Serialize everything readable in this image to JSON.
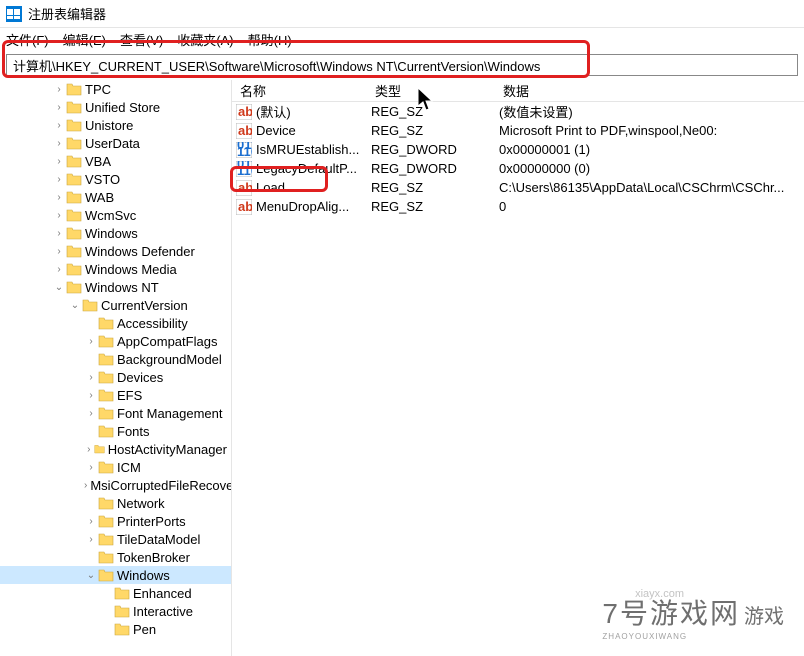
{
  "title": "注册表编辑器",
  "menu": {
    "file": "文件(F)",
    "edit": "编辑(E)",
    "view": "查看(V)",
    "favorites": "收藏夹(A)",
    "help": "帮助(H)"
  },
  "address": "计算机\\HKEY_CURRENT_USER\\Software\\Microsoft\\Windows NT\\CurrentVersion\\Windows",
  "list_headers": {
    "name": "名称",
    "type": "类型",
    "data": "数据"
  },
  "values": [
    {
      "icon": "sz",
      "name": "(默认)",
      "type": "REG_SZ",
      "data": "(数值未设置)"
    },
    {
      "icon": "sz",
      "name": "Device",
      "type": "REG_SZ",
      "data": "Microsoft Print to PDF,winspool,Ne00:"
    },
    {
      "icon": "dw",
      "name": "IsMRUEstablish...",
      "type": "REG_DWORD",
      "data": "0x00000001 (1)"
    },
    {
      "icon": "dw",
      "name": "LegacyDefaultP...",
      "type": "REG_DWORD",
      "data": "0x00000000 (0)"
    },
    {
      "icon": "sz",
      "name": "Load",
      "type": "REG_SZ",
      "data": "C:\\Users\\86135\\AppData\\Local\\CSChrm\\CSChr..."
    },
    {
      "icon": "sz",
      "name": "MenuDropAlig...",
      "type": "REG_SZ",
      "data": "0"
    }
  ],
  "tree": [
    {
      "indent": 3,
      "exp": ">",
      "label": "TPC"
    },
    {
      "indent": 3,
      "exp": ">",
      "label": "Unified Store"
    },
    {
      "indent": 3,
      "exp": ">",
      "label": "Unistore"
    },
    {
      "indent": 3,
      "exp": ">",
      "label": "UserData"
    },
    {
      "indent": 3,
      "exp": ">",
      "label": "VBA"
    },
    {
      "indent": 3,
      "exp": ">",
      "label": "VSTO"
    },
    {
      "indent": 3,
      "exp": ">",
      "label": "WAB"
    },
    {
      "indent": 3,
      "exp": ">",
      "label": "WcmSvc"
    },
    {
      "indent": 3,
      "exp": ">",
      "label": "Windows"
    },
    {
      "indent": 3,
      "exp": ">",
      "label": "Windows Defender"
    },
    {
      "indent": 3,
      "exp": ">",
      "label": "Windows Media"
    },
    {
      "indent": 3,
      "exp": "v",
      "label": "Windows NT"
    },
    {
      "indent": 4,
      "exp": "v",
      "label": "CurrentVersion"
    },
    {
      "indent": 5,
      "exp": "",
      "label": "Accessibility"
    },
    {
      "indent": 5,
      "exp": ">",
      "label": "AppCompatFlags"
    },
    {
      "indent": 5,
      "exp": "",
      "label": "BackgroundModel"
    },
    {
      "indent": 5,
      "exp": ">",
      "label": "Devices"
    },
    {
      "indent": 5,
      "exp": ">",
      "label": "EFS"
    },
    {
      "indent": 5,
      "exp": ">",
      "label": "Font Management"
    },
    {
      "indent": 5,
      "exp": "",
      "label": "Fonts"
    },
    {
      "indent": 5,
      "exp": ">",
      "label": "HostActivityManager"
    },
    {
      "indent": 5,
      "exp": ">",
      "label": "ICM"
    },
    {
      "indent": 5,
      "exp": ">",
      "label": "MsiCorruptedFileRecovery"
    },
    {
      "indent": 5,
      "exp": "",
      "label": "Network"
    },
    {
      "indent": 5,
      "exp": ">",
      "label": "PrinterPorts"
    },
    {
      "indent": 5,
      "exp": ">",
      "label": "TileDataModel"
    },
    {
      "indent": 5,
      "exp": "",
      "label": "TokenBroker"
    },
    {
      "indent": 5,
      "exp": "v",
      "label": "Windows",
      "selected": true
    },
    {
      "indent": 6,
      "exp": "",
      "label": "Enhanced"
    },
    {
      "indent": 6,
      "exp": "",
      "label": "Interactive"
    },
    {
      "indent": 6,
      "exp": "",
      "label": "Pen"
    }
  ],
  "watermark": {
    "main": "7号游戏网",
    "side": "游戏",
    "url": "xiayx.com",
    "sub": "ZHAOYOUXIWANG"
  }
}
